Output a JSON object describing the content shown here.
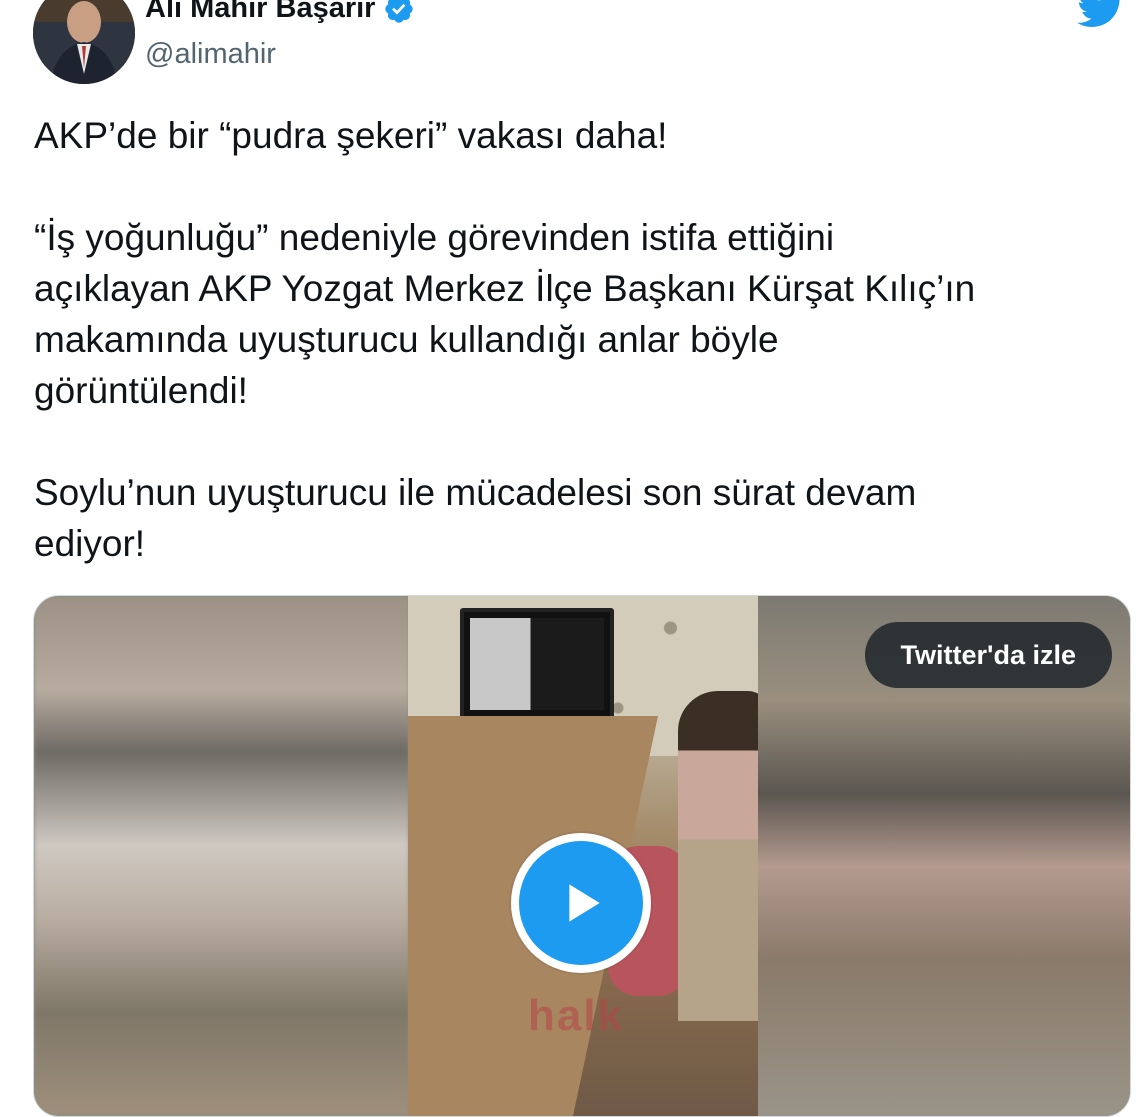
{
  "author": {
    "display_name": "Ali Mahir Başarır",
    "handle": "@alimahir",
    "verified": true
  },
  "tweet": {
    "paragraphs": [
      [
        "AKP’de bir “pudra şekeri” vakası daha!"
      ],
      [
        "“İş yoğunluğu” nedeniyle görevinden istifa ettiğini",
        "açıklayan AKP Yozgat Merkez İlçe Başkanı Kürşat Kılıç’ın",
        "makamında uyuşturucu kullandığı anlar böyle",
        "görüntülendi!"
      ],
      [
        "Soylu’nun uyuşturucu ile mücadelesi son sürat devam",
        "ediyor!"
      ]
    ]
  },
  "media": {
    "watch_label": "Twitter'da izle",
    "watermark": "halk"
  },
  "icons": {
    "brand": "twitter-bird-icon",
    "verified": "verified-badge-icon",
    "play": "play-icon"
  },
  "colors": {
    "brand_blue": "#1d9bf0",
    "text": "#0f1419",
    "secondary_text": "#536471",
    "pill_bg": "#272c30"
  }
}
